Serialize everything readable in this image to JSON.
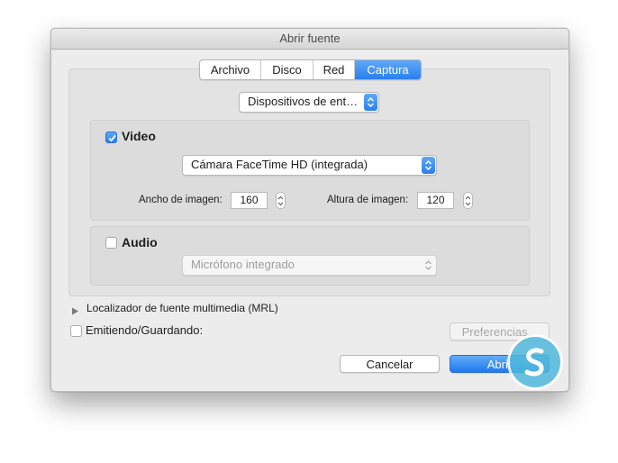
{
  "window": {
    "title": "Abrir fuente"
  },
  "tabs": [
    {
      "label": "Archivo",
      "active": false
    },
    {
      "label": "Disco",
      "active": false
    },
    {
      "label": "Red",
      "active": false
    },
    {
      "label": "Captura",
      "active": true
    }
  ],
  "source_popup": {
    "value": "Dispositivos de ent…"
  },
  "video": {
    "label": "Video",
    "checked": true,
    "device": "Cámara FaceTime HD (integrada)",
    "width_label": "Ancho de imagen:",
    "width_value": "160",
    "height_label": "Altura de imagen:",
    "height_value": "120"
  },
  "audio": {
    "label": "Audio",
    "checked": false,
    "device": "Micrófono integrado"
  },
  "mrl": {
    "label": "Localizador de fuente multimedia (MRL)"
  },
  "streaming": {
    "label": "Emitiendo/Guardando:",
    "checked": false
  },
  "buttons": {
    "preferences": "Preferencias...",
    "cancel": "Cancelar",
    "open": "Abrir"
  },
  "colors": {
    "accent": "#2a7fef",
    "watermark": "#50b9dc"
  }
}
